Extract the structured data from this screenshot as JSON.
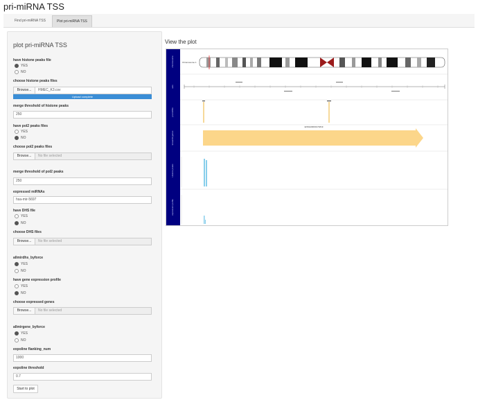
{
  "app": {
    "title": "pri-miRNA TSS"
  },
  "tabs": [
    {
      "label": "Find pri-miRNA TSS"
    },
    {
      "label": "Plot pri-miRNA TSS"
    }
  ],
  "sidebar": {
    "title": "plot pri-miRNA TSS",
    "have_histone": {
      "label": "have histone peaks file",
      "options": [
        "YES",
        "NO"
      ],
      "selected": "YES"
    },
    "histone_file": {
      "label": "choose histone peaks files",
      "browse": "Browse...",
      "filename": "HMEC_K3.csv",
      "progress": "Upload complete"
    },
    "histone_merge": {
      "label": "merge threshold of histone peaks",
      "value": "250"
    },
    "have_pol2": {
      "label": "have pol2 peaks files",
      "options": [
        "YES",
        "NO"
      ],
      "selected": "NO"
    },
    "pol2_file": {
      "label": "choose pol2 peaks files",
      "browse": "Browse...",
      "filename": "No file selected"
    },
    "pol2_merge": {
      "label": "merge threshold of pol2 peaks",
      "value": "250"
    },
    "expressed_mirna": {
      "label": "expressed miRNAs",
      "value": "hsa-mir-5697"
    },
    "have_dhs": {
      "label": "have DHS file",
      "options": [
        "YES",
        "NO"
      ],
      "selected": "NO"
    },
    "dhs_file": {
      "label": "choose DHS files",
      "browse": "Browse...",
      "filename": "No file selected"
    },
    "allmirdhs": {
      "label": "allmirdhs_byforce",
      "options": [
        "YES",
        "NO"
      ],
      "selected": "YES"
    },
    "have_gene_expr": {
      "label": "have gene expression profile",
      "options": [
        "YES",
        "NO"
      ],
      "selected": "NO"
    },
    "gene_file": {
      "label": "choose expressed genes",
      "browse": "Browse...",
      "filename": "No file selected"
    },
    "allmirgene": {
      "label": "allmirgene_byforce",
      "options": [
        "YES",
        "NO"
      ],
      "selected": "YES"
    },
    "flanking": {
      "label": "expoline flanking_num",
      "value": "1000"
    },
    "threshold": {
      "label": "expoline threshold",
      "value": "0.7"
    },
    "start_button": "Start to plot"
  },
  "plot": {
    "title": "View the plot",
    "tracks": [
      {
        "name": "chromosome"
      },
      {
        "name": "axis"
      },
      {
        "name": "pri-miRNA"
      },
      {
        "name": "Ensembl genes"
      },
      {
        "name": "Histone peaks"
      },
      {
        "name": "expression profile"
      }
    ],
    "ideogram_label": "Chromosome 1",
    "gene_label": "ENSG00000171819"
  },
  "colors": {
    "track_bg": "#000080",
    "gene_arrow": "#fcd68a",
    "peak": "#87ceeb",
    "mirna": "#e8a000",
    "progress": "#3b8ed6"
  }
}
